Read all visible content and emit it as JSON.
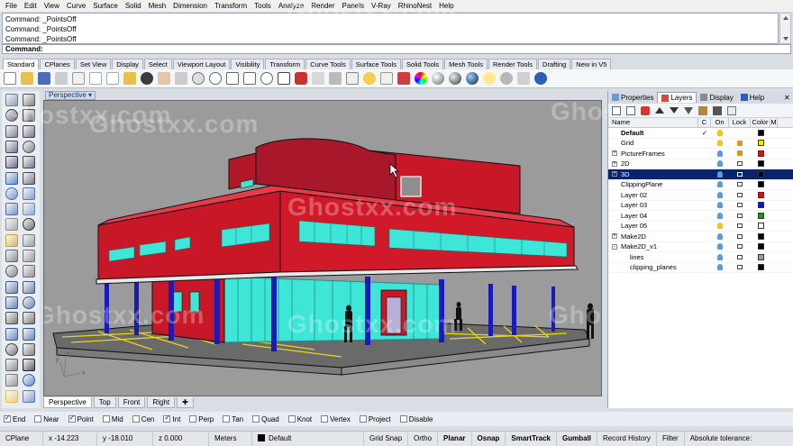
{
  "menu": [
    "File",
    "Edit",
    "View",
    "Curve",
    "Surface",
    "Solid",
    "Mesh",
    "Dimension",
    "Transform",
    "Tools",
    "Analyze",
    "Render",
    "Panels",
    "V-Ray",
    "RhinoNest",
    "Help"
  ],
  "command_history": [
    "Command: _PointsOff",
    "Command: _PointsOff",
    "Command: _PointsOff"
  ],
  "command_prompt": "Command:",
  "toolbar_tabs": [
    "Standard",
    "CPlanes",
    "Set View",
    "Display",
    "Select",
    "Viewport Layout",
    "Visibility",
    "Transform",
    "Curve Tools",
    "Surface Tools",
    "Solid Tools",
    "Mesh Tools",
    "Render Tools",
    "Drafting",
    "New in V5"
  ],
  "active_toolbar_tab": "Standard",
  "viewport": {
    "label": "Perspective",
    "watermark": "Ghostxx.com",
    "axis": {
      "x": "x",
      "y": "y",
      "z": "z"
    }
  },
  "viewport_tabs": [
    "Perspective",
    "Top",
    "Front",
    "Right"
  ],
  "panel": {
    "tabs": [
      "Properties",
      "Layers",
      "Display",
      "Help"
    ],
    "active_tab": "Layers",
    "columns": {
      "name": "Name",
      "current": "C",
      "on": "On",
      "lock": "Lock",
      "color": "Color",
      "m": "M"
    },
    "layers": [
      {
        "name": "Default",
        "current": "✓",
        "indent": 0,
        "bold": true,
        "expander": "",
        "on": "yellow",
        "lock": "",
        "color": "#000000"
      },
      {
        "name": "Grid",
        "current": "",
        "indent": 0,
        "bold": false,
        "expander": "",
        "on": "yellow",
        "lock": "locked",
        "color": "#f5e600"
      },
      {
        "name": "PictureFrames",
        "current": "",
        "indent": 0,
        "bold": false,
        "expander": "+",
        "on": "blue",
        "lock": "locked",
        "color": "#e01010"
      },
      {
        "name": "2D",
        "current": "",
        "indent": 0,
        "bold": false,
        "expander": "+",
        "on": "blue",
        "lock": "unlocked",
        "color": "#000000"
      },
      {
        "name": "3D",
        "current": "",
        "indent": 0,
        "bold": false,
        "expander": "+",
        "on": "blue",
        "lock": "unlocked",
        "color": "#000000",
        "selected": true
      },
      {
        "name": "ClippingPlane",
        "current": "",
        "indent": 0,
        "bold": false,
        "expander": "",
        "on": "blue",
        "lock": "unlocked",
        "color": "#000000"
      },
      {
        "name": "Layer 02",
        "current": "",
        "indent": 0,
        "bold": false,
        "expander": "",
        "on": "blue",
        "lock": "unlocked",
        "color": "#e01010"
      },
      {
        "name": "Layer 03",
        "current": "",
        "indent": 0,
        "bold": false,
        "expander": "",
        "on": "blue",
        "lock": "unlocked",
        "color": "#1010e0"
      },
      {
        "name": "Layer 04",
        "current": "",
        "indent": 0,
        "bold": false,
        "expander": "",
        "on": "blue",
        "lock": "unlocked",
        "color": "#10a010"
      },
      {
        "name": "Layer 05",
        "current": "",
        "indent": 0,
        "bold": false,
        "expander": "",
        "on": "yellow",
        "lock": "unlocked",
        "color": "#ffffff"
      },
      {
        "name": "Make2D",
        "current": "",
        "indent": 0,
        "bold": false,
        "expander": "+",
        "on": "blue",
        "lock": "unlocked",
        "color": "#000000"
      },
      {
        "name": "Make2D_v1",
        "current": "",
        "indent": 0,
        "bold": false,
        "expander": "-",
        "on": "blue",
        "lock": "unlocked",
        "color": "#000000"
      },
      {
        "name": "lines",
        "current": "",
        "indent": 1,
        "bold": false,
        "expander": "",
        "on": "blue",
        "lock": "unlocked",
        "color": "#9a9a9a"
      },
      {
        "name": "clipping_planes",
        "current": "",
        "indent": 1,
        "bold": false,
        "expander": "",
        "on": "blue",
        "lock": "unlocked",
        "color": "#000000"
      }
    ]
  },
  "osnaps": [
    {
      "label": "End",
      "checked": true
    },
    {
      "label": "Near",
      "checked": false
    },
    {
      "label": "Point",
      "checked": true
    },
    {
      "label": "Mid",
      "checked": false
    },
    {
      "label": "Cen",
      "checked": false
    },
    {
      "label": "Int",
      "checked": true
    },
    {
      "label": "Perp",
      "checked": false
    },
    {
      "label": "Tan",
      "checked": false
    },
    {
      "label": "Quad",
      "checked": false
    },
    {
      "label": "Knot",
      "checked": false
    },
    {
      "label": "Vertex",
      "checked": false
    },
    {
      "label": "Project",
      "checked": false
    },
    {
      "label": "Disable",
      "checked": false
    }
  ],
  "status": {
    "cplane": "CPlane",
    "x": "x -14.223",
    "y": "y -18.010",
    "z": "z 0.000",
    "units": "Meters",
    "layer": "Default",
    "grid_snap": "Grid Snap",
    "ortho": "Ortho",
    "planar": "Planar",
    "osnap": "Osnap",
    "smarttrack": "SmartTrack",
    "gumball": "Gumball",
    "record_history": "Record History",
    "filter": "Filter",
    "tolerance": "Absolute tolerance:"
  },
  "colors": {
    "building_red": "#c81828",
    "glass_cyan": "#3ee6d8",
    "column_blue": "#1a1ab8",
    "ground": "#5a5a5a",
    "parking_lines": "#e8d41a",
    "selection": "#0a246a"
  }
}
